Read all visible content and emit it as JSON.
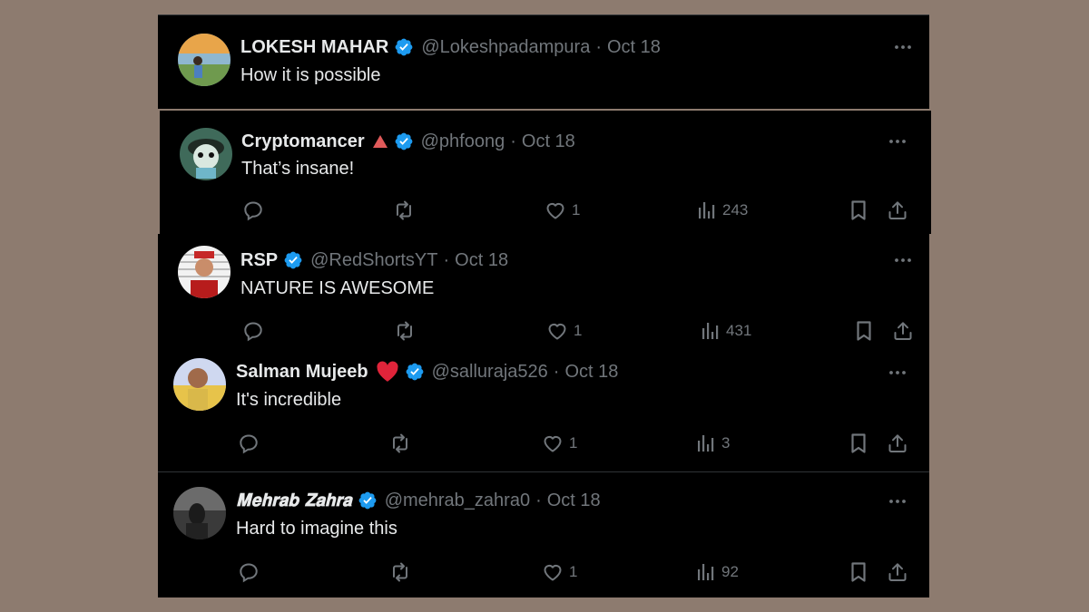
{
  "colors": {
    "verified": "#1d9bf0",
    "muted": "#71767b",
    "text": "#e7e9ea"
  },
  "posts": [
    {
      "name": "LOKESH MAHAR",
      "handle": "@Lokeshpadampura",
      "dot": "·",
      "date": "Oct 18",
      "text": "How it is possible"
    },
    {
      "name": "Cryptomancer",
      "emoji": "red-triangle",
      "handle": "@phfoong",
      "dot": "·",
      "date": "Oct 18",
      "text": "That’s insane!",
      "likes": "1",
      "views": "243"
    },
    {
      "name": "RSP",
      "handle": "@RedShortsYT",
      "dot": "·",
      "date": "Oct 18",
      "text": "NATURE IS AWESOME",
      "likes": "1",
      "views": "431"
    },
    {
      "name": "Salman Mujeeb",
      "emoji": "red-heart",
      "handle": "@salluraja526",
      "dot": "·",
      "date": "Oct 18",
      "text": "It's incredible",
      "likes": "1",
      "views": "3"
    },
    {
      "name": "𝐌𝐞𝐡𝐫𝐚𝐛 𝐙𝐚𝐡𝐫𝐚",
      "handle": "@mehrab_zahra0",
      "dot": "·",
      "date": "Oct 18",
      "text": "Hard to imagine this",
      "likes": "1",
      "views": "92"
    }
  ]
}
